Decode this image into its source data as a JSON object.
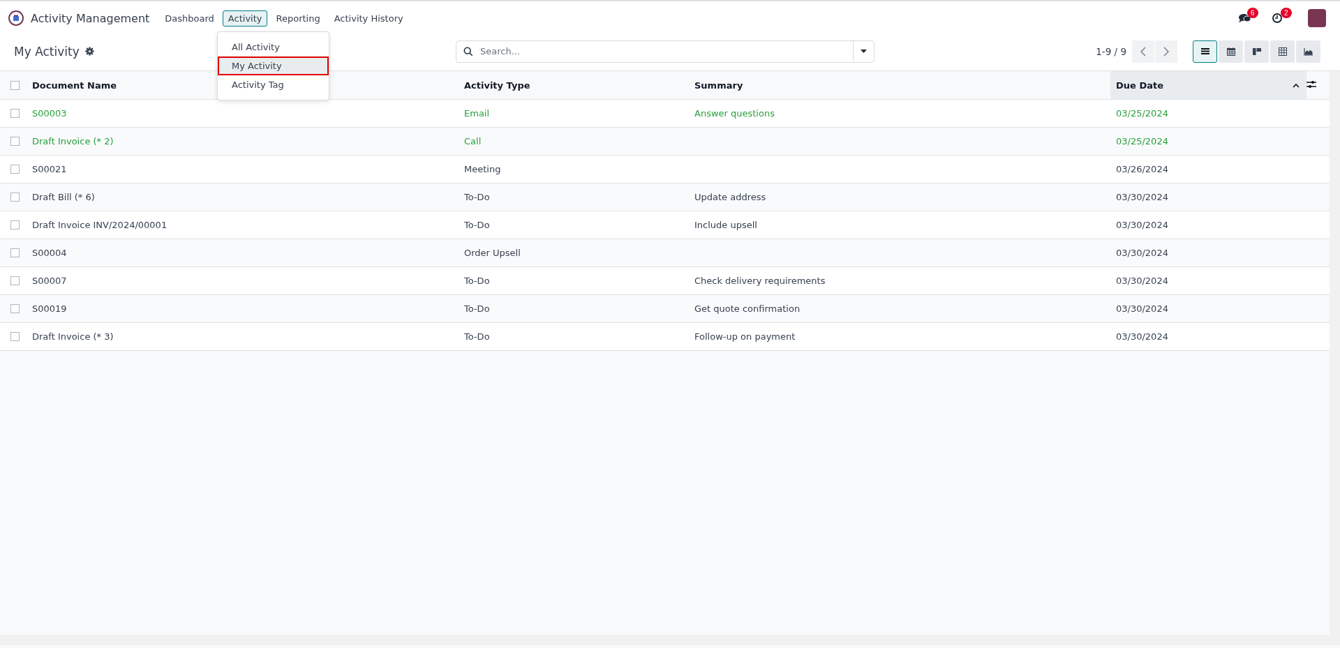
{
  "app": {
    "name": "Activity Management"
  },
  "menu": [
    {
      "label": "Dashboard",
      "selected": false
    },
    {
      "label": "Activity",
      "selected": true
    },
    {
      "label": "Reporting",
      "selected": false
    },
    {
      "label": "Activity History",
      "selected": false
    }
  ],
  "dropdown": [
    {
      "label": "All Activity",
      "selected": false
    },
    {
      "label": "My Activity",
      "selected": true
    },
    {
      "label": "Activity Tag",
      "selected": false
    }
  ],
  "systray": {
    "messages_badge": "6",
    "activities_badge": "2"
  },
  "control_panel": {
    "title": "My Activity",
    "search": {
      "placeholder": "Search..."
    },
    "pager": "1-9 / 9",
    "views": [
      {
        "kind": "list",
        "selected": true
      },
      {
        "kind": "calendar",
        "selected": false
      },
      {
        "kind": "kanban",
        "selected": false
      },
      {
        "kind": "pivot",
        "selected": false
      },
      {
        "kind": "graph",
        "selected": false
      }
    ]
  },
  "table": {
    "all_checked": false,
    "columns": [
      "Document Name",
      "Activity Type",
      "Summary",
      "Due Date"
    ],
    "rows": [
      {
        "cells": [
          "S00003",
          "Email",
          "Answer questions",
          "03/25/2024"
        ],
        "color": "#28a03c",
        "checked": false
      },
      {
        "cells": [
          "Draft Invoice (* 2)",
          "Call",
          "",
          "03/25/2024"
        ],
        "color": "#28a03c",
        "checked": false
      },
      {
        "cells": [
          "S00021",
          "Meeting",
          "",
          "03/26/2024"
        ],
        "color": "#374151",
        "checked": false
      },
      {
        "cells": [
          "Draft Bill (* 6)",
          "To-Do",
          "Update address",
          "03/30/2024"
        ],
        "color": "#374151",
        "checked": false
      },
      {
        "cells": [
          "Draft Invoice INV/2024/00001",
          "To-Do",
          "Include upsell",
          "03/30/2024"
        ],
        "color": "#374151",
        "checked": false
      },
      {
        "cells": [
          "S00004",
          "Order Upsell",
          "",
          "03/30/2024"
        ],
        "color": "#374151",
        "checked": false
      },
      {
        "cells": [
          "S00007",
          "To-Do",
          "Check delivery requirements",
          "03/30/2024"
        ],
        "color": "#374151",
        "checked": false
      },
      {
        "cells": [
          "S00019",
          "To-Do",
          "Get quote confirmation",
          "03/30/2024"
        ],
        "color": "#374151",
        "checked": false
      },
      {
        "cells": [
          "Draft Invoice (* 3)",
          "To-Do",
          "Follow-up on payment",
          "03/30/2024"
        ],
        "color": "#374151",
        "checked": false
      }
    ]
  }
}
